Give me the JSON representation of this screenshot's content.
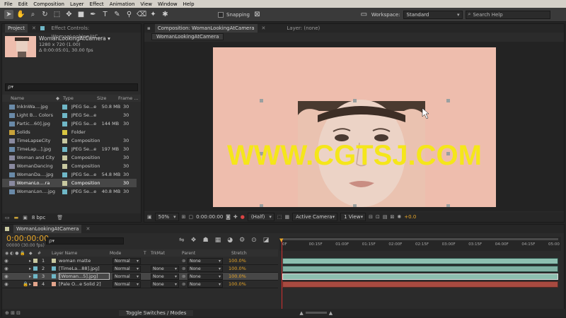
{
  "menu": [
    "File",
    "Edit",
    "Composition",
    "Layer",
    "Effect",
    "Animation",
    "View",
    "Window",
    "Help"
  ],
  "toolbar": {
    "snapping_label": "Snapping",
    "workspace_label": "Workspace:",
    "workspace_value": "Standard",
    "search_placeholder": "Search Help"
  },
  "project_panel": {
    "tab_project": "Project",
    "tab_effect_controls": "Effect Controls: WomanLookingAtC...",
    "selected_name": "WomanLookingAtCamera ▾",
    "selected_info1": "1280 x 720 (1.00)",
    "selected_info2": "Δ 0:00:05:01, 30.00 fps",
    "search_placeholder": "ρ▾",
    "columns": {
      "name": "Name",
      "type": "Type",
      "size": "Size",
      "frame": "Frame ..."
    },
    "items": [
      {
        "name": "InkInWa....jpg",
        "type": "JPEG Se...e",
        "size": "50.8 MB",
        "frame": "30",
        "kind": "jpg",
        "color": "#6fb7c7"
      },
      {
        "name": "Light B... Colors",
        "type": "JPEG Se...e",
        "size": "",
        "frame": "30",
        "kind": "jpg",
        "color": "#6fb7c7"
      },
      {
        "name": "Partic...60].jpg",
        "type": "JPEG Se...e",
        "size": "144 MB",
        "frame": "30",
        "kind": "jpg",
        "color": "#6fb7c7"
      },
      {
        "name": "Solids",
        "type": "Folder",
        "size": "",
        "frame": "",
        "kind": "folder",
        "color": "#d8c640"
      },
      {
        "name": "TimeLapseCity",
        "type": "Composition",
        "size": "",
        "frame": "30",
        "kind": "comp",
        "color": "#c8c8a0"
      },
      {
        "name": "TimeLap...].jpg",
        "type": "JPEG Se...e",
        "size": "197 MB",
        "frame": "30",
        "kind": "jpg",
        "color": "#6fb7c7"
      },
      {
        "name": "Woman and City",
        "type": "Composition",
        "size": "",
        "frame": "30",
        "kind": "comp",
        "color": "#c8c8a0"
      },
      {
        "name": "WomanDancing",
        "type": "Composition",
        "size": "",
        "frame": "30",
        "kind": "comp",
        "color": "#c8c8a0"
      },
      {
        "name": "WomanDa....jpg",
        "type": "JPEG Se...e",
        "size": "54.8 MB",
        "frame": "30",
        "kind": "jpg",
        "color": "#6fb7c7"
      },
      {
        "name": "WomanLo....ra",
        "type": "Composition",
        "size": "",
        "frame": "30",
        "kind": "comp",
        "color": "#c8c8a0",
        "selected": true
      },
      {
        "name": "WomanLon....jpg",
        "type": "JPEG Se...e",
        "size": "40.8 MB",
        "frame": "30",
        "kind": "jpg",
        "color": "#6fb7c7"
      }
    ],
    "bpc_label": "8 bpc"
  },
  "comp_panel": {
    "tab_label": "Composition: WomanLookingAtCamera",
    "layer_tab": "Layer: (none)",
    "subtab": "WomanLookingAtCamera",
    "zoom": "50%",
    "timecode": "0:00:00:00",
    "resolution": "(Half)",
    "camera": "Active Camera",
    "view": "1 View",
    "exposure": "+0.0",
    "bg_color": "#eebdad",
    "watermark": "WWW.CGTSJ.COM"
  },
  "timeline": {
    "tab_label": "WomanLookingAtCamera",
    "timecode": "0:00:00:00",
    "frames_info": "00000 (30.00 fps)",
    "search_placeholder": "ρ▾",
    "headers": {
      "layer_name": "Layer Name",
      "mode": "Mode",
      "t": "T",
      "trkmat": "TrkMat",
      "parent": "Parent",
      "stretch": "Stretch",
      "num": "#"
    },
    "ruler": [
      "0F",
      "00:15F",
      "01:00F",
      "01:15F",
      "02:00F",
      "02:15F",
      "03:00F",
      "03:15F",
      "04:00F",
      "04:15F",
      "05:00"
    ],
    "layers": [
      {
        "num": "1",
        "name": "woman matte",
        "mode": "Normal",
        "trkmat": "",
        "parent": "None",
        "stretch": "100.0%",
        "label": "#c8c8a0"
      },
      {
        "num": "2",
        "name": "[TimeLa...88].jpg]",
        "mode": "Normal",
        "trkmat": "None",
        "parent": "None",
        "stretch": "100.0%",
        "label": "#6fb7c7"
      },
      {
        "num": "3",
        "name": "[Woman...5].jpg]",
        "mode": "Normal",
        "trkmat": "None",
        "parent": "None",
        "stretch": "100.0%",
        "label": "#6fb7c7",
        "selected": true
      },
      {
        "num": "4",
        "name": "[Pale O...e Solid 2]",
        "mode": "Normal",
        "trkmat": "None",
        "parent": "None",
        "stretch": "100.0%",
        "label": "#e3a58c"
      }
    ],
    "toggle_label": "Toggle Switches / Modes"
  }
}
